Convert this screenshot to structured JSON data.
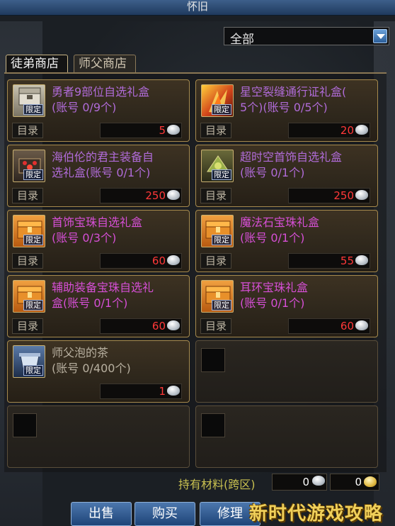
{
  "window": {
    "title": "怀旧"
  },
  "filter": {
    "selected": "全部"
  },
  "tabs": [
    {
      "label": "徒弟商店",
      "active": true
    },
    {
      "label": "师父商店",
      "active": false
    }
  ],
  "common": {
    "catalog_label": "目录",
    "limited_label": "限定"
  },
  "items": [
    {
      "name": "勇者9部位自选礼盒\n(账号 0/9个)",
      "price": "5",
      "color": "purple",
      "icon": "stone-chest-icon"
    },
    {
      "name": "星空裂缝通行证礼盒(\n5个)(账号 0/5个)",
      "price": "20",
      "color": "purple",
      "icon": "fire-claw-icon"
    },
    {
      "name": "海伯伦的君主装备自\n选礼盒(账号 0/1个)",
      "price": "250",
      "color": "purple",
      "icon": "red-gem-chest-icon"
    },
    {
      "name": "超时空首饰自选礼盒\n(账号 0/1个)",
      "price": "250",
      "color": "purple",
      "icon": "green-ornament-chest-icon"
    },
    {
      "name": "首饰宝珠自选礼盒\n(账号 0/3个)",
      "price": "60",
      "color": "pink",
      "icon": "gold-chest-icon"
    },
    {
      "name": "魔法石宝珠礼盒\n(账号 0/1个)",
      "price": "55",
      "color": "pink",
      "icon": "gold-chest-icon"
    },
    {
      "name": "辅助装备宝珠自选礼\n盒(账号 0/1个)",
      "price": "60",
      "color": "pink",
      "icon": "gold-chest-icon"
    },
    {
      "name": "耳环宝珠礼盒\n(账号 0/1个)",
      "price": "60",
      "color": "pink",
      "icon": "gold-chest-icon"
    },
    {
      "name": "师父泡的茶\n(账号 0/400个)",
      "price": "1",
      "color": "purple",
      "icon": "tea-cup-icon"
    }
  ],
  "materials": {
    "label": "持有材料(跨区)",
    "silver_value": "0",
    "gold_value": "0"
  },
  "buttons": {
    "sell": "出售",
    "buy": "购买",
    "repair": "修理"
  },
  "watermark": "新时代游戏攻略",
  "colors": {
    "purple_text": "#b06bd8",
    "pink_text": "#d64fd6",
    "price_red": "#ff3838",
    "frame_gold": "#a68a4d",
    "button_blue": "#2c5f9a"
  }
}
